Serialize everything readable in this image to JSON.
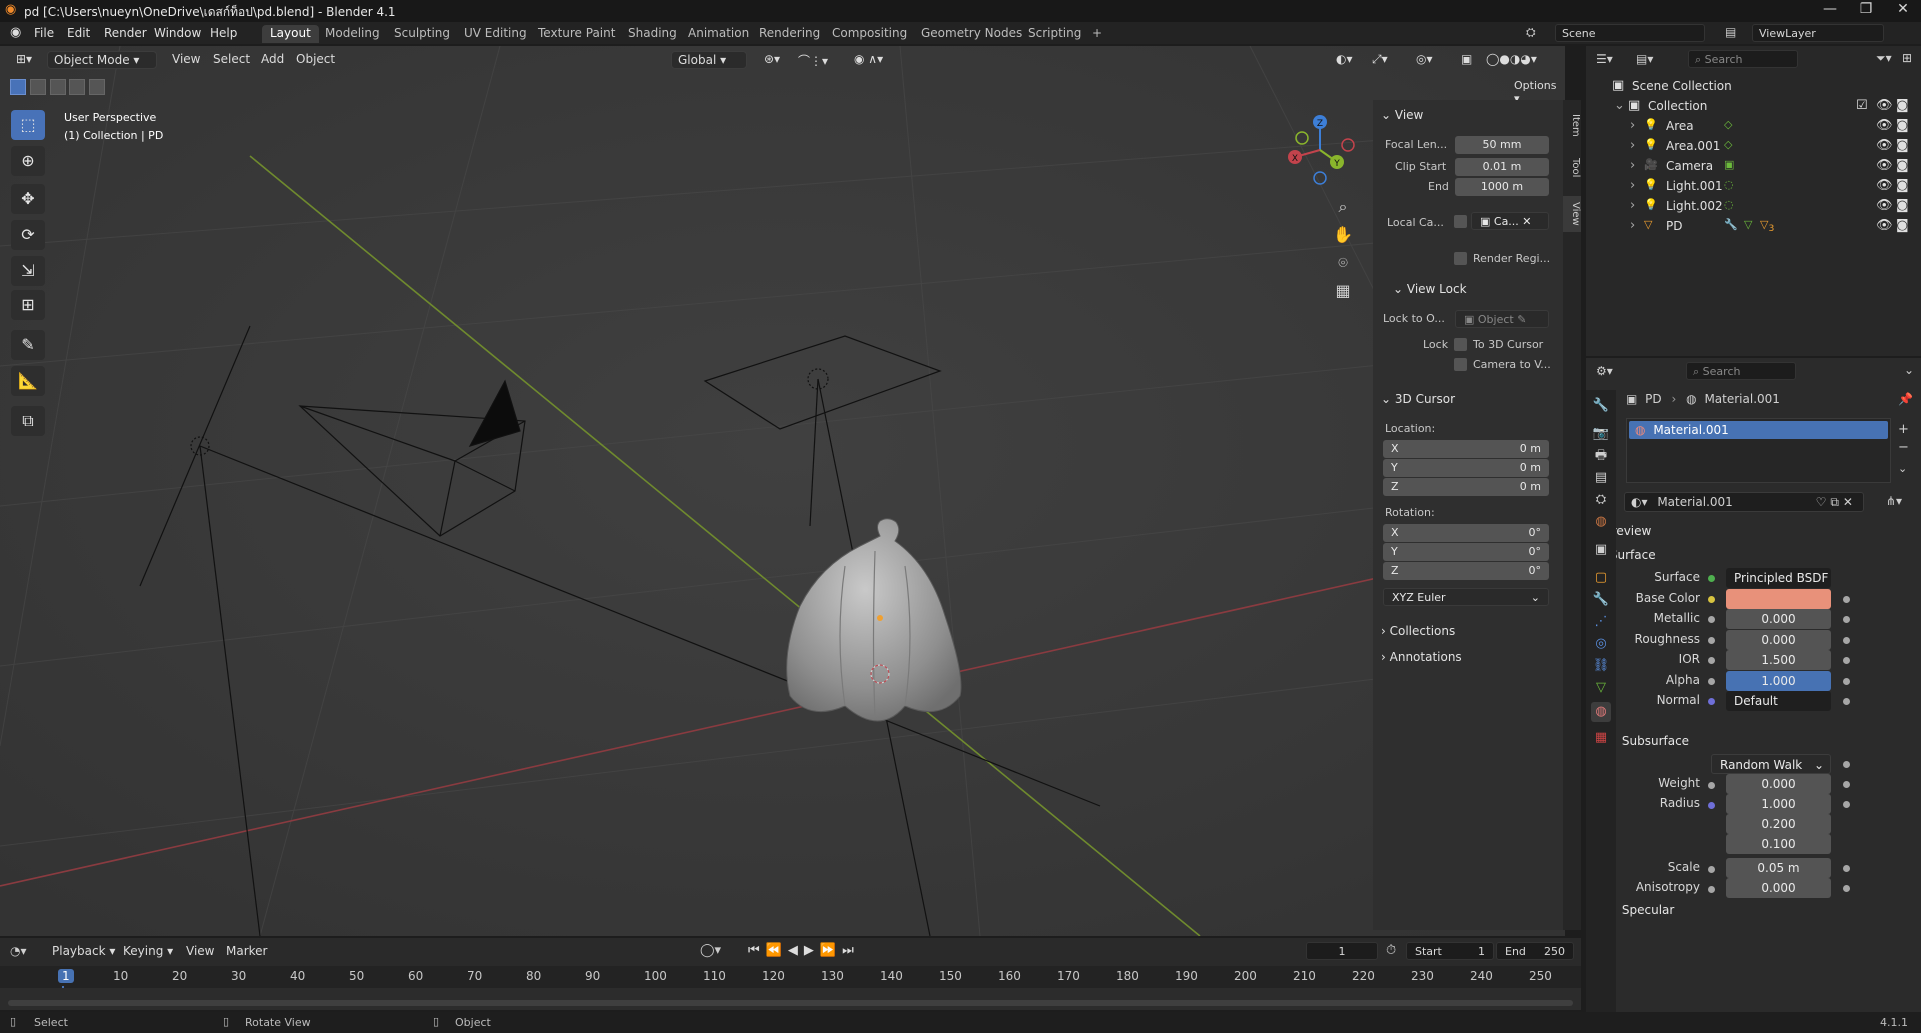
{
  "window": {
    "title": "pd [C:\\Users\\nueyn\\OneDrive\\เดสก์ท็อป\\pd.blend] - Blender 4.1",
    "controls": [
      "—",
      "❐",
      "✕"
    ]
  },
  "menu": [
    "File",
    "Edit",
    "Render",
    "Window",
    "Help"
  ],
  "workspaces": [
    "Layout",
    "Modeling",
    "Sculpting",
    "UV Editing",
    "Texture Paint",
    "Shading",
    "Animation",
    "Rendering",
    "Compositing",
    "Geometry Nodes",
    "Scripting",
    "+"
  ],
  "active_workspace": "Layout",
  "scene": {
    "scene_name": "Scene",
    "view_layer": "ViewLayer"
  },
  "viewport": {
    "mode": "Object Mode",
    "menus": [
      "View",
      "Select",
      "Add",
      "Object"
    ],
    "transform_orientation": "Global",
    "options_label": "Options",
    "overlay_text": {
      "line1": "User Perspective",
      "line2": "(1) Collection | PD"
    },
    "tools": [
      "select-box-icon",
      "cursor-icon",
      "move-icon",
      "rotate-icon",
      "scale-icon",
      "transform-icon",
      "annotate-icon",
      "measure-icon",
      "add-cube-icon"
    ],
    "gizmo_axes": {
      "x": "X",
      "y": "Y",
      "z": "Z"
    },
    "nav_buttons": [
      "zoom-icon",
      "hand-pan-icon",
      "camera-view-icon",
      "grid-ortho-icon"
    ]
  },
  "npanel": {
    "tabs": [
      "Item",
      "Tool",
      "View"
    ],
    "active_tab": "View",
    "view_section": "View",
    "focal_length_label": "Focal Len...",
    "focal_length": "50 mm",
    "clip_start_label": "Clip Start",
    "clip_start": "0.01 m",
    "clip_end_label": "End",
    "clip_end": "1000 m",
    "local_camera_label": "Local Ca...",
    "local_camera_value": "Ca...",
    "render_region_label": "Render Regi...",
    "view_lock_section": "View Lock",
    "lock_to_object_label": "Lock to O...",
    "lock_to_object_placeholder": "Object",
    "lock_label": "Lock",
    "to_3d_cursor": "To 3D Cursor",
    "camera_to_view": "Camera to V...",
    "cursor_section": "3D Cursor",
    "location_label": "Location:",
    "loc": [
      {
        "axis": "X",
        "value": "0 m"
      },
      {
        "axis": "Y",
        "value": "0 m"
      },
      {
        "axis": "Z",
        "value": "0 m"
      }
    ],
    "rotation_label": "Rotation:",
    "rot": [
      {
        "axis": "X",
        "value": "0°"
      },
      {
        "axis": "Y",
        "value": "0°"
      },
      {
        "axis": "Z",
        "value": "0°"
      }
    ],
    "rotation_mode": "XYZ Euler",
    "collections_section": "Collections",
    "annotations_section": "Annotations"
  },
  "timeline": {
    "menus": [
      "Playback",
      "Keying",
      "View",
      "Marker"
    ],
    "current_frame": "1",
    "start_label": "Start",
    "start": "1",
    "end_label": "End",
    "end": "250",
    "ruler": [
      "1",
      "10",
      "20",
      "30",
      "40",
      "50",
      "60",
      "70",
      "80",
      "90",
      "100",
      "110",
      "120",
      "130",
      "140",
      "150",
      "160",
      "170",
      "180",
      "190",
      "200",
      "210",
      "220",
      "230",
      "240",
      "250"
    ]
  },
  "statusbar": {
    "select": "Select",
    "rotate_view": "Rotate View",
    "object": "Object",
    "version": "4.1.1"
  },
  "outliner": {
    "search_placeholder": "Search",
    "scene_collection": "Scene Collection",
    "collection": "Collection",
    "items": [
      {
        "name": "Area",
        "icon": "light-icon",
        "data_icon": "area-light-data-icon"
      },
      {
        "name": "Area.001",
        "icon": "light-icon",
        "data_icon": "area-light-data-icon"
      },
      {
        "name": "Camera",
        "icon": "camera-icon",
        "data_icon": "camera-data-icon"
      },
      {
        "name": "Light.001",
        "icon": "light-icon",
        "data_icon": "point-light-data-icon"
      },
      {
        "name": "Light.002",
        "icon": "light-icon",
        "data_icon": "point-light-data-icon"
      },
      {
        "name": "PD",
        "icon": "mesh-icon",
        "data_icon": "modifier-icon",
        "material_count": "3"
      }
    ]
  },
  "properties": {
    "search_placeholder": "Search",
    "breadcrumb": {
      "object": "PD",
      "material": "Material.001"
    },
    "slot": "Material.001",
    "material_name": "Material.001",
    "preview_section": "Preview",
    "surface_section": "Surface",
    "fields": [
      {
        "label": "Surface",
        "value": "Principled BSDF",
        "kind": "shader"
      },
      {
        "label": "Base Color",
        "value": "",
        "kind": "color"
      },
      {
        "label": "Metallic",
        "value": "0.000",
        "kind": "number"
      },
      {
        "label": "Roughness",
        "value": "0.000",
        "kind": "number"
      },
      {
        "label": "IOR",
        "value": "1.500",
        "kind": "number"
      },
      {
        "label": "Alpha",
        "value": "1.000",
        "kind": "slider-full"
      },
      {
        "label": "Normal",
        "value": "Default",
        "kind": "link"
      }
    ],
    "subsurface_section": "Subsurface",
    "subsurface_method": "Random Walk",
    "weight_label": "Weight",
    "weight": "0.000",
    "radius_label": "Radius",
    "radius": [
      "1.000",
      "0.200",
      "0.100"
    ],
    "scale_label": "Scale",
    "scale": "0.05 m",
    "anisotropy_label": "Anisotropy",
    "anisotropy": "0.000",
    "specular_section": "Specular"
  },
  "colors": {
    "accent": "#4772b3",
    "base_color": "#e8917a",
    "x_axis": "#c3434c",
    "y_axis": "#8ab52c",
    "z_axis": "#3d7fd8",
    "viewport_bg": "#393939"
  }
}
